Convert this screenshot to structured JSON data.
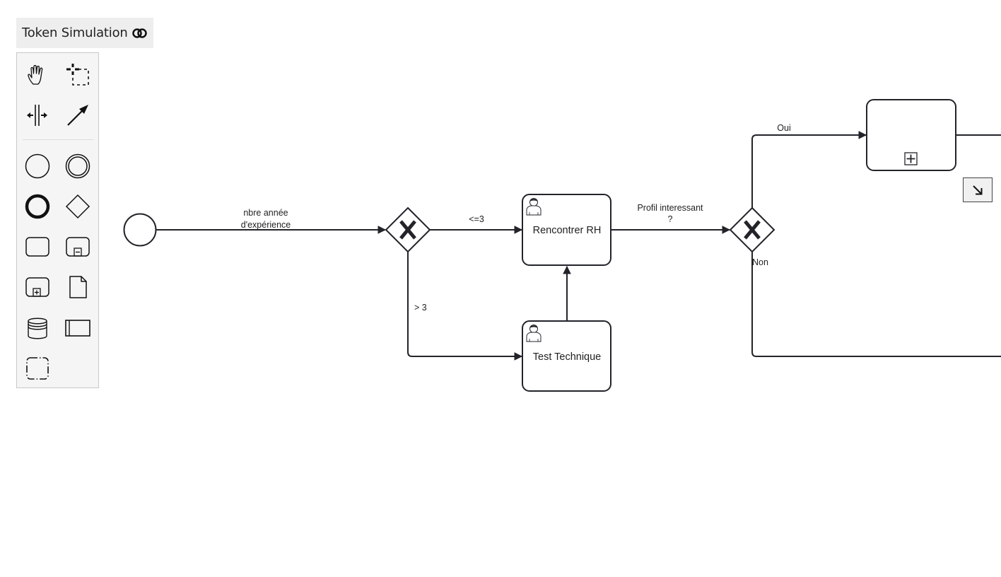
{
  "token_simulation": {
    "label": "Token Simulation",
    "icon": "toggle-icon"
  },
  "palette": {
    "tools": [
      {
        "name": "hand-tool",
        "icon": "hand-icon"
      },
      {
        "name": "lasso-tool",
        "icon": "lasso-icon"
      },
      {
        "name": "space-tool",
        "icon": "space-tool-icon"
      },
      {
        "name": "global-connect-tool",
        "icon": "connect-arrow-icon"
      }
    ],
    "elements": [
      {
        "name": "start-event",
        "icon": "start-event-icon"
      },
      {
        "name": "intermediate-event",
        "icon": "intermediate-event-icon"
      },
      {
        "name": "end-event",
        "icon": "end-event-icon"
      },
      {
        "name": "gateway",
        "icon": "gateway-icon"
      },
      {
        "name": "task",
        "icon": "task-icon"
      },
      {
        "name": "subprocess-collapsed",
        "icon": "subprocess-collapsed-icon"
      },
      {
        "name": "subprocess-expanded",
        "icon": "subprocess-expanded-icon"
      },
      {
        "name": "data-object",
        "icon": "data-object-icon"
      },
      {
        "name": "data-store",
        "icon": "data-store-icon"
      },
      {
        "name": "participant",
        "icon": "participant-icon"
      },
      {
        "name": "group",
        "icon": "group-icon"
      }
    ]
  },
  "diagram": {
    "flows": {
      "start_to_gw1": "nbre année|d'expérience",
      "gw1_to_rh": "<=3",
      "gw1_to_test": "> 3",
      "rh_to_gw2": "Profil interessant|?",
      "gw2_oui": "Oui",
      "gw2_non": "Non"
    },
    "tasks": {
      "rencontrer_rh": "Rencontrer RH",
      "test_technique": "Test Technique",
      "subprocess": ""
    }
  },
  "minimap": {
    "icon": "open-minimap-icon"
  },
  "colors": {
    "stroke": "#22242a",
    "palette_bg": "#f5f5f5",
    "toggle_bg": "#eeeeee"
  }
}
